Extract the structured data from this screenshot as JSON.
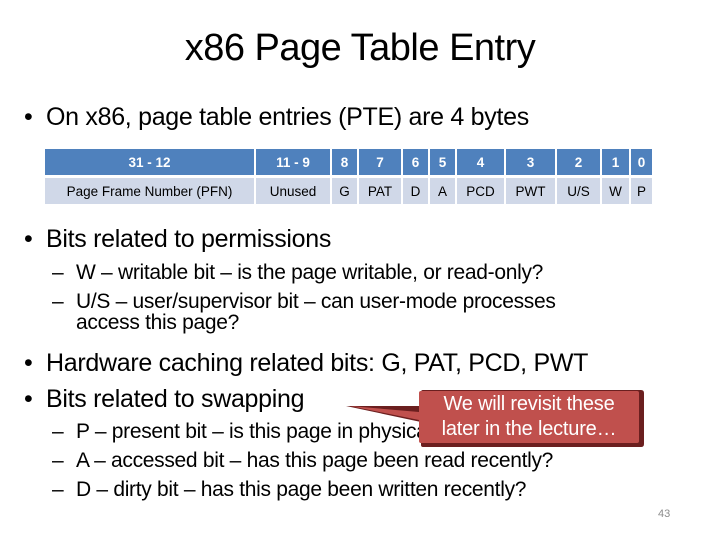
{
  "slide": {
    "title": "x86 Page Table Entry",
    "page_number": "43",
    "bullets": [
      {
        "marker": "•",
        "text": "On x86, page table entries (PTE) are 4 bytes"
      },
      {
        "marker": "•",
        "text": "Bits related to permissions",
        "sub": [
          {
            "marker": "–",
            "text": "W – writable bit – is the page writable, or read-only?"
          },
          {
            "marker": "–",
            "text": "U/S – user/supervisor bit – can user-mode processes",
            "continuation": "access this page?"
          }
        ]
      },
      {
        "marker": "•",
        "text": "Hardware caching related bits: G, PAT, PCD, PWT"
      },
      {
        "marker": "•",
        "text": "Bits related to swapping",
        "sub": [
          {
            "marker": "–",
            "text": "P – present bit – is this page in physical memory?"
          },
          {
            "marker": "–",
            "text": "A – accessed bit – has this page been read recently?"
          },
          {
            "marker": "–",
            "text": "D – dirty bit – has this page been written recently?"
          }
        ]
      }
    ],
    "pte_table": {
      "bits": [
        "31 - 12",
        "11 - 9",
        "8",
        "7",
        "6",
        "5",
        "4",
        "3",
        "2",
        "1",
        "0"
      ],
      "fields": [
        "Page Frame Number (PFN)",
        "Unused",
        "G",
        "PAT",
        "D",
        "A",
        "PCD",
        "PWT",
        "U/S",
        "W",
        "P"
      ]
    },
    "callout": {
      "line1": "We will revisit these",
      "line2": "later in the lecture…"
    },
    "colors": {
      "table_header": "#4F81BD",
      "table_body": "#D0D8E8",
      "callout_fill": "#C0504D",
      "callout_shadow": "#6B1F1F"
    }
  }
}
